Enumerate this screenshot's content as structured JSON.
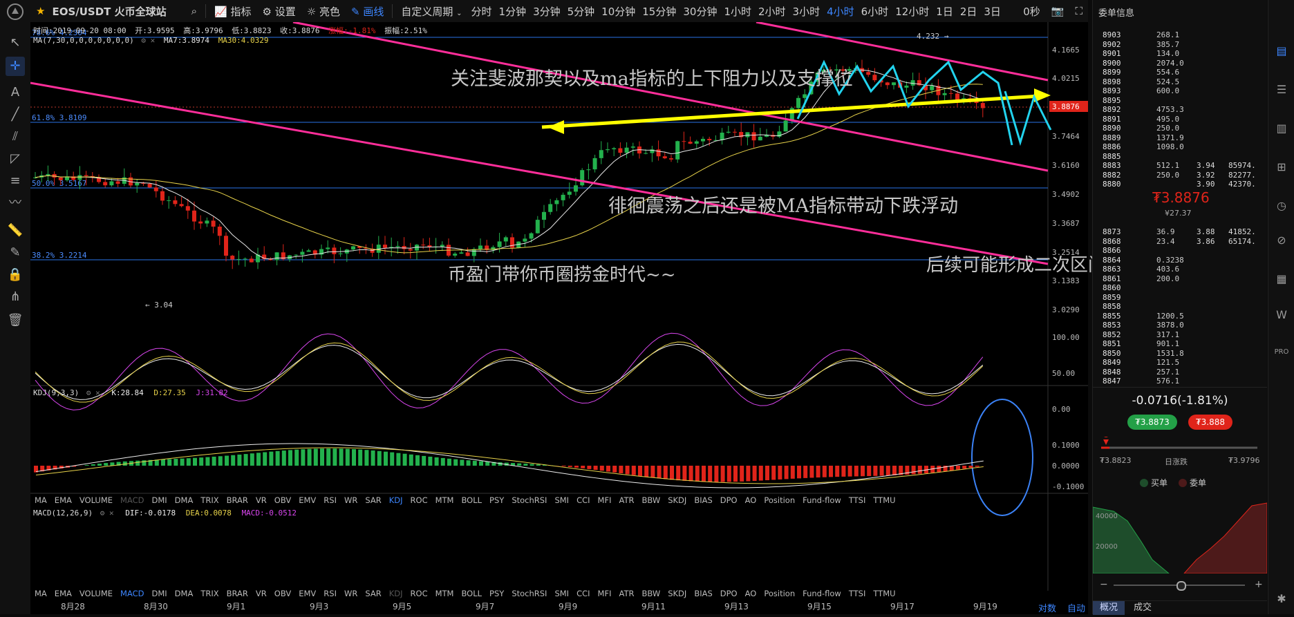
{
  "toolbar": {
    "symbol": "EOS/USDT 火币全球站",
    "indicators": "指标",
    "settings": "设置",
    "brightness": "亮色",
    "draw": "画线",
    "custom_period": "自定义周期",
    "periods": [
      "分时",
      "1分钟",
      "3分钟",
      "5分钟",
      "10分钟",
      "15分钟",
      "30分钟",
      "1小时",
      "2小时",
      "3小时",
      "4小时",
      "6小时",
      "12小时",
      "1日",
      "2日",
      "3日"
    ],
    "active_period": "4小时",
    "countdown": "0秒"
  },
  "ohlc_header": {
    "time": "时间:2019-09-20 08:00",
    "open": "开:3.9595",
    "high": "高:3.9796",
    "low": "低:3.8823",
    "close": "收:3.8876",
    "change": "涨幅:-1.81%",
    "amplitude": "振幅:2.51%"
  },
  "ma_header": {
    "ma": "MA(7,30,0,0,0,0,0,0,0)",
    "ma7": "MA7:3.8974",
    "ma30": "MA30:4.0329"
  },
  "fib": {
    "f786": "78.6% 4.2304",
    "f618": "61.8% 3.8109",
    "f50": "50.0% 3.5167",
    "f382": "38.2% 3.2214"
  },
  "price_marks": {
    "high_mark": "4.232",
    "low_mark": "3.04",
    "current": "3.8876"
  },
  "price_axis": [
    "4.1665",
    "4.0215",
    "3.8876",
    "3.7464",
    "3.6160",
    "3.4902",
    "3.3687",
    "3.2514",
    "3.1383",
    "3.0290"
  ],
  "annotations": {
    "a1": "关注斐波那契以及ma指标的上下阻力以及支撑位",
    "a2": "徘徊震荡之后还是被MA指标带动下跌浮动",
    "a3": "币盈门带你币圈捞金时代~~",
    "a4": "后续可能形成二次区间徘徊"
  },
  "kdj": {
    "label": "KDJ(9,3,3)",
    "k": "K:28.84",
    "d": "D:27.35",
    "j": "J:31.82",
    "axis": [
      "100.00",
      "50.00",
      "0.00"
    ]
  },
  "indicator_tabs": [
    "MA",
    "EMA",
    "VOLUME",
    "MACD",
    "DMI",
    "DMA",
    "TRIX",
    "BRAR",
    "VR",
    "OBV",
    "EMV",
    "RSI",
    "WR",
    "SAR",
    "KDJ",
    "ROC",
    "MTM",
    "BOLL",
    "PSY",
    "StochRSI",
    "SMI",
    "CCI",
    "MFI",
    "ATR",
    "BBW",
    "SKDJ",
    "BIAS",
    "DPO",
    "AO",
    "Position",
    "Fund-flow",
    "TTSI",
    "TTMU"
  ],
  "macd": {
    "label": "MACD(12,26,9)",
    "dif": "DIF:-0.0178",
    "dea": "DEA:0.0078",
    "macd": "MACD:-0.0512",
    "axis": [
      "0.1000",
      "0.0000",
      "-0.1000"
    ]
  },
  "date_axis": [
    "8月28",
    "8月30",
    "9月1",
    "9月3",
    "9月5",
    "9月7",
    "9月9",
    "9月11",
    "9月13",
    "9月15",
    "9月17",
    "9月19"
  ],
  "bottom_right": {
    "log": "对数",
    "auto": "自动"
  },
  "right_panel": {
    "title": "委单信息",
    "asks": [
      {
        "price": "8903",
        "amount": "268.1"
      },
      {
        "price": "8902",
        "amount": "385.7"
      },
      {
        "price": "8901",
        "amount": "134.0"
      },
      {
        "price": "8900",
        "amount": "2074.0"
      },
      {
        "price": "8899",
        "amount": "554.6"
      },
      {
        "price": "8898",
        "amount": "524.5"
      },
      {
        "price": "8893",
        "amount": "600.0"
      },
      {
        "price": "8895",
        "amount": ""
      },
      {
        "price": "8892",
        "amount": "4753.3"
      },
      {
        "price": "8891",
        "amount": "495.0"
      },
      {
        "price": "8890",
        "amount": "250.0"
      },
      {
        "price": "8889",
        "amount": "1371.9"
      },
      {
        "price": "8886",
        "amount": "1098.0"
      },
      {
        "price": "8885",
        "amount": ""
      },
      {
        "price": "8883",
        "amount": "512.1"
      },
      {
        "price": "8882",
        "amount": "250.0"
      },
      {
        "price": "8880",
        "amount": ""
      }
    ],
    "ask_extra": [
      {
        "p": "3.94",
        "v": "85974."
      },
      {
        "p": "3.92",
        "v": "82277."
      },
      {
        "p": "3.90",
        "v": "42370."
      }
    ],
    "last_price": "₮3.8876",
    "last_cny": "¥27.37",
    "bids": [
      {
        "price": "8873",
        "amount": "36.9"
      },
      {
        "price": "8868",
        "amount": "23.4"
      },
      {
        "price": "8866",
        "amount": ""
      },
      {
        "price": "8864",
        "amount": "0.3238"
      },
      {
        "price": "8863",
        "amount": "403.6"
      },
      {
        "price": "8861",
        "amount": "200.0"
      },
      {
        "price": "8860",
        "amount": ""
      },
      {
        "price": "8859",
        "amount": ""
      },
      {
        "price": "8858",
        "amount": ""
      },
      {
        "price": "8855",
        "amount": "1200.5"
      },
      {
        "price": "8853",
        "amount": "3878.0"
      },
      {
        "price": "8852",
        "amount": "317.1"
      },
      {
        "price": "8851",
        "amount": "901.1"
      },
      {
        "price": "8850",
        "amount": "1531.8"
      },
      {
        "price": "8849",
        "amount": "121.5"
      },
      {
        "price": "8848",
        "amount": "257.1"
      },
      {
        "price": "8847",
        "amount": "576.1"
      }
    ],
    "bid_extra": [
      {
        "p": "3.88",
        "v": "41852."
      },
      {
        "p": "3.86",
        "v": "65174."
      }
    ],
    "change": "-0.0716(-1.81%)",
    "buy_price": "₮3.8873",
    "sell_price": "₮3.888",
    "range_low": "₮3.8823",
    "range_label": "日涨跌",
    "range_high": "₮3.9796",
    "legend_buy": "买单",
    "legend_sell": "委单",
    "depth_axis": [
      "40000",
      "20000"
    ],
    "tabs": [
      "概况",
      "成交"
    ]
  },
  "colors": {
    "up": "#23b14d",
    "down": "#e0241a",
    "fib_line": "#2a73e8",
    "channel": "#ff2e9a",
    "arrow": "#ffff00",
    "zigzag": "#22d3ee",
    "annotation_yellow": "#f5f542",
    "annotation_red": "#ff3333",
    "annotation_magenta": "#e52fe0",
    "accent": "#3d86ff"
  }
}
